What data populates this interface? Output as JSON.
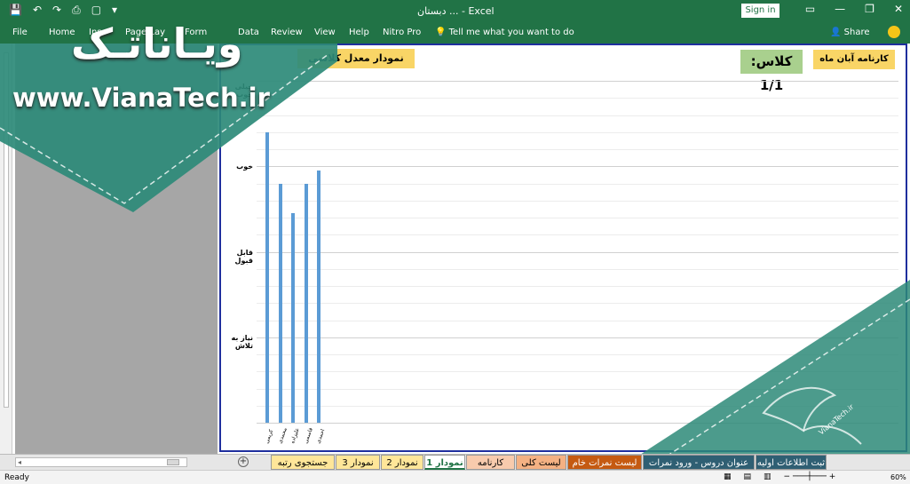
{
  "app": {
    "title": "دبستان ... - Excel",
    "signin_label": "Sign in",
    "tell_me": "Tell me what you want to do",
    "share": "Share",
    "window_controls": {
      "ribbon_display": "▭",
      "minimize": "—",
      "restore": "❐",
      "close": "✕"
    }
  },
  "qat": {
    "save_icon": "💾",
    "undo_icon": "↶",
    "redo_icon": "↷",
    "print_icon": "⎙",
    "new_icon": "▢",
    "more_icon": "▾"
  },
  "ribbon_tabs": [
    "File",
    "Home",
    "Ins",
    "Page Lay",
    "Form",
    "Data",
    "Review",
    "View",
    "Help",
    "Nitro Pro"
  ],
  "watermark": {
    "title": "ویـاناتـک",
    "url": "www.VianaTech.ir",
    "badge_text": "VianaTech.ir"
  },
  "report": {
    "title": "کارنامه آبان ماه",
    "class_label": "کلاس: 1/1",
    "chart_button": "نمودار معدل کلاسی"
  },
  "chart_data": {
    "type": "bar",
    "title": "",
    "xlabel": "",
    "ylabel": "",
    "y_levels": [
      "نیاز به تلاش",
      "قابل قبول",
      "خوب",
      "خیلی خوب"
    ],
    "ylim": [
      0,
      4
    ],
    "categories": [
      "کریمی",
      "محمدی",
      "علیزاده",
      "قاسمی",
      "احمدی"
    ],
    "values": [
      3.4,
      2.8,
      2.45,
      2.8,
      2.95
    ],
    "gridlines": true,
    "bar_color": "#5b9bd5"
  },
  "sheet_tabs": [
    {
      "label": "ثبت اطلاعات اولیه",
      "bg": "#2f5f73",
      "color": "#ffffff"
    },
    {
      "label": "عنوان دروس - ورود نمرات",
      "bg": "#2f5f73",
      "color": "#ffffff"
    },
    {
      "label": "لیست نمرات خام",
      "bg": "#c55a11",
      "color": "#ffffff"
    },
    {
      "label": "لیست کلی",
      "bg": "#f4b183",
      "color": "#000000"
    },
    {
      "label": "کارنامه",
      "bg": "#f8cbad",
      "color": "#000000"
    },
    {
      "label": "نمودار 1",
      "bg": "#ffffff",
      "color": "#217346",
      "active": true
    },
    {
      "label": "نمودار 2",
      "bg": "#ffe699",
      "color": "#000000"
    },
    {
      "label": "نمودار 3",
      "bg": "#ffe699",
      "color": "#000000"
    },
    {
      "label": "جستجوی رتبه",
      "bg": "#ffe699",
      "color": "#000000"
    }
  ],
  "status": {
    "ready": "Ready",
    "zoom": "60%"
  },
  "colors": {
    "excel_green": "#217346",
    "teal": "#2d8a78",
    "chart_border": "#1f2f9e"
  }
}
